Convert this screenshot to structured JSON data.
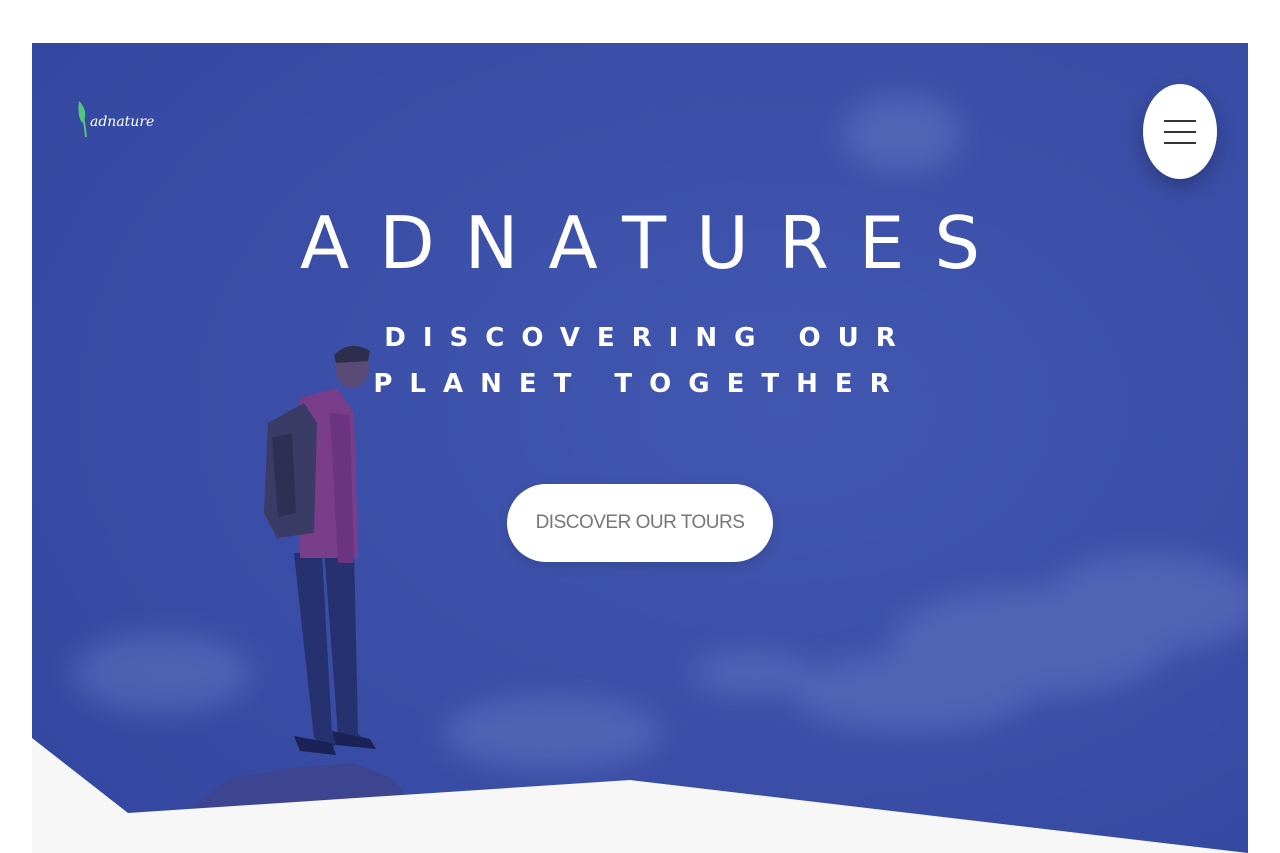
{
  "header": {
    "logo_text": "adnature",
    "menu_icon": "hamburger-menu-icon"
  },
  "hero": {
    "title": "ADNATURES",
    "subtitle": "DISCOVERING OUR PLANET TOGETHER",
    "cta_label": "DISCOVER OUR TOURS"
  },
  "colors": {
    "hero_overlay": "#3a4fa6",
    "bottom_section": "#f7f7f7",
    "logo_leaf": "#55c57a",
    "button_bg": "#ffffff",
    "button_text": "#777777"
  }
}
